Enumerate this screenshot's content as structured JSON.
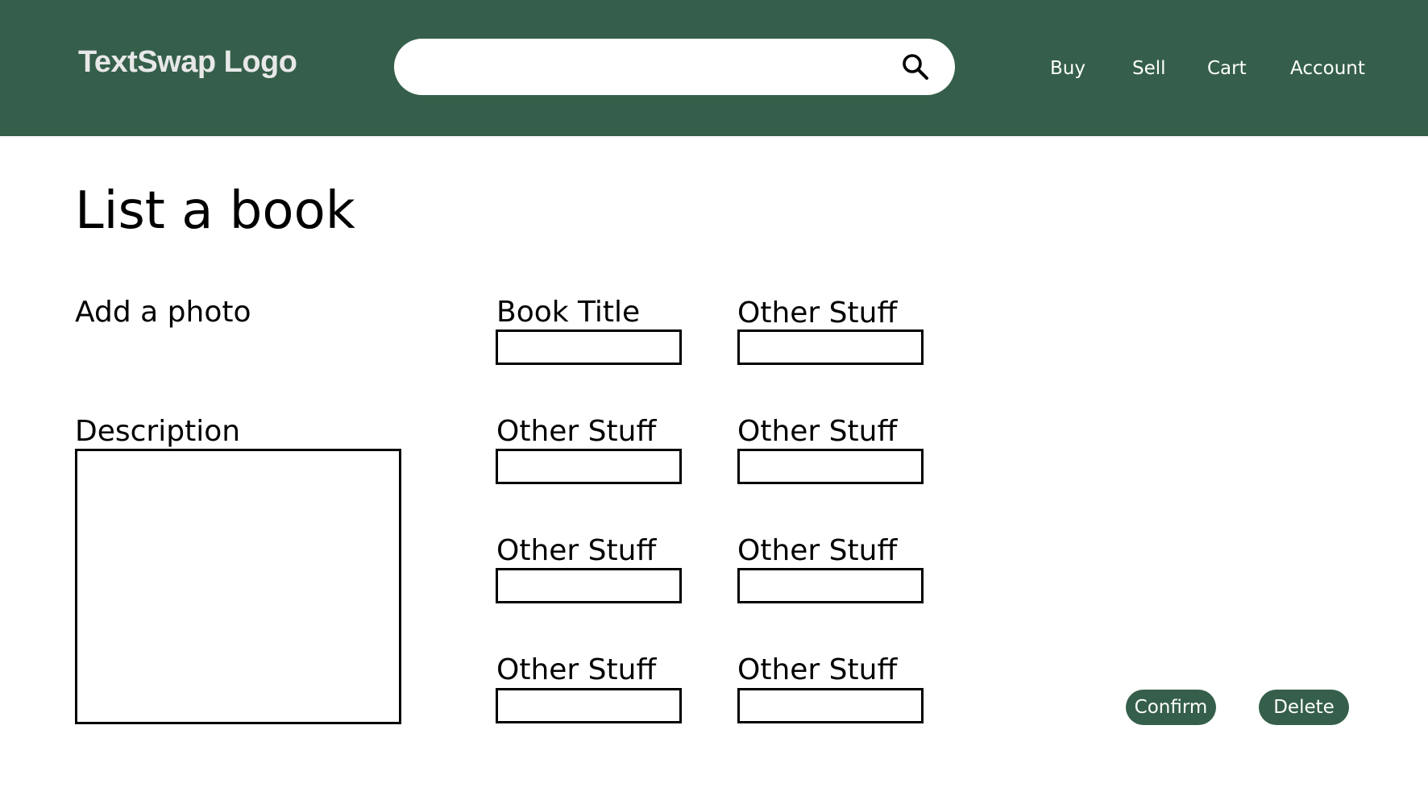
{
  "header": {
    "logo_text": "TextSwap Logo",
    "search": {
      "value": "",
      "placeholder": "",
      "icon": "search-icon"
    },
    "nav": [
      {
        "label": "Buy"
      },
      {
        "label": "Sell"
      },
      {
        "label": "Cart"
      },
      {
        "label": "Account"
      }
    ]
  },
  "form": {
    "title": "List a book",
    "add_photo_label": "Add a photo",
    "description_label": "Description",
    "fields": [
      {
        "label": "Book Title",
        "value": ""
      },
      {
        "label": "Other Stuff",
        "value": ""
      },
      {
        "label": "Other Stuff",
        "value": ""
      },
      {
        "label": "Other Stuff",
        "value": ""
      },
      {
        "label": "Other Stuff",
        "value": ""
      },
      {
        "label": "Other Stuff",
        "value": ""
      },
      {
        "label": "Other Stuff",
        "value": ""
      },
      {
        "label": "Other Stuff",
        "value": ""
      }
    ],
    "actions": {
      "confirm_label": "Confirm",
      "delete_label": "Delete"
    }
  },
  "colors": {
    "brand_green": "#355f4a",
    "header_text": "#ffffff",
    "logo_text": "#e8e8e8"
  }
}
